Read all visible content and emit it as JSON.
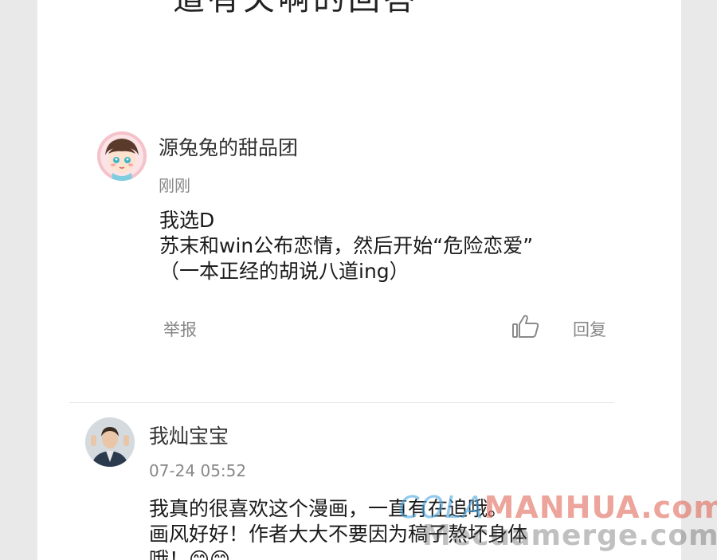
{
  "previous_heading_fragment": "道有关啊的回答",
  "comments": [
    {
      "username": "源兔兔的甜品团",
      "time": "刚刚",
      "lines": [
        "我选D",
        "苏末和win公布恋情，然后开始“危险恋爱”",
        "（一本正经的胡说八道ing）"
      ],
      "report_label": "举报",
      "reply_label": "回复",
      "like_icon": "thumbs-up-icon"
    },
    {
      "username": "我灿宝宝",
      "time": "07-24 05:52",
      "lines": [
        " 我真的很喜欢这个漫画，一直有在追哦。",
        "画风好好！作者大大不要因为稿子熬坏身体",
        "哦！😊😊"
      ]
    }
  ],
  "watermark": {
    "prefix": "COLA",
    "main": "MANHUA",
    "suffix": ".com",
    "secondary": "Mecuamerge.com"
  },
  "colors": {
    "background": "#e9e9e9",
    "card": "#ffffff",
    "text_primary": "#1a1a1a",
    "text_secondary": "#888888"
  }
}
